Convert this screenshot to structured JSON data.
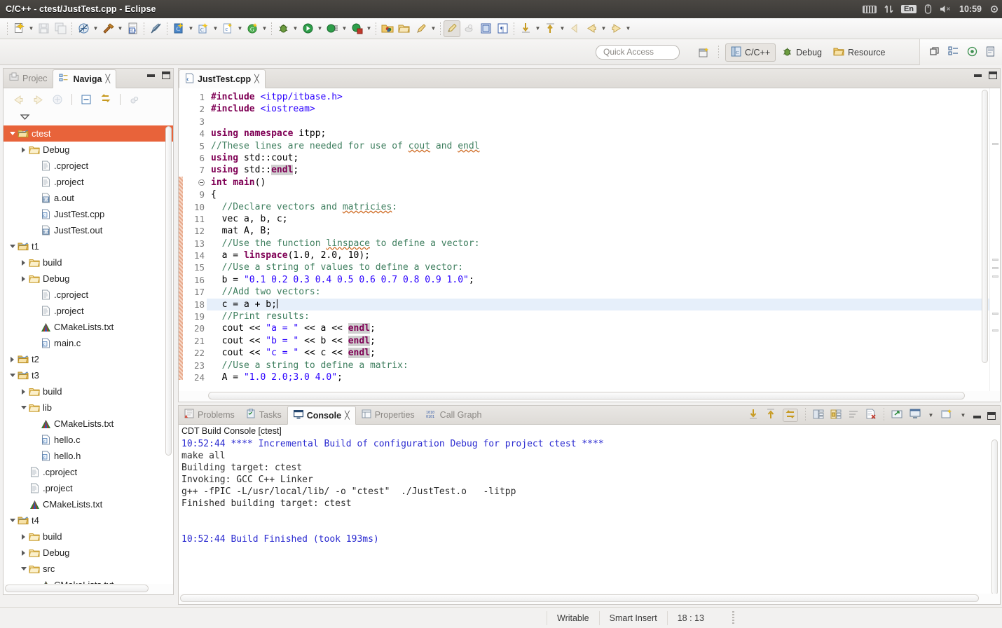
{
  "window": {
    "title": "C/C++ - ctest/JustTest.cpp - Eclipse"
  },
  "systray": {
    "keyboard_icon": "keyboard-icon",
    "network_icon": "network-updown-icon",
    "language": "En",
    "bluetooth_icon": "bluetooth-icon",
    "volume_icon": "volume-muted-icon",
    "clock": "10:59",
    "power_icon": "gear-power-icon"
  },
  "toolbar": {
    "groups": [
      {
        "items": [
          {
            "name": "new-button",
            "icon": "new-file-icon",
            "arrow": true
          },
          {
            "name": "save-button",
            "icon": "save-icon",
            "arrow": false,
            "disabled": true
          },
          {
            "name": "save-all-button",
            "icon": "save-all-icon",
            "arrow": false,
            "disabled": true
          }
        ]
      },
      {
        "items": [
          {
            "name": "build-all-button",
            "icon": "build-all-icon",
            "arrow": true
          },
          {
            "name": "build-button",
            "icon": "hammer-icon",
            "arrow": true
          },
          {
            "name": "binary-button",
            "icon": "binary-file-icon",
            "arrow": false
          }
        ]
      },
      {
        "items": [
          {
            "name": "toggle-markers-button",
            "icon": "pencil-strike-icon",
            "arrow": false
          }
        ]
      },
      {
        "items": [
          {
            "name": "new-c-project-button",
            "icon": "c-project-icon",
            "arrow": true
          },
          {
            "name": "new-cpp-class-button",
            "icon": "cpp-class-icon",
            "arrow": true
          },
          {
            "name": "new-c-file-button",
            "icon": "c-file-icon",
            "arrow": true
          },
          {
            "name": "new-git-button",
            "icon": "green-new-icon",
            "arrow": true
          }
        ]
      },
      {
        "items": [
          {
            "name": "debug-button",
            "icon": "bug-icon",
            "arrow": true
          },
          {
            "name": "run-button",
            "icon": "run-green-icon",
            "arrow": true
          },
          {
            "name": "profile-button",
            "icon": "profile-icon",
            "arrow": true
          },
          {
            "name": "stop-build-button",
            "icon": "run-stop-icon",
            "arrow": true
          }
        ]
      },
      {
        "items": [
          {
            "name": "open-element-button",
            "icon": "open-element-icon",
            "arrow": false
          },
          {
            "name": "search-resource-button",
            "icon": "color-folder-icon",
            "arrow": false
          },
          {
            "name": "open-folder-button",
            "icon": "open-folder-icon",
            "arrow": false
          },
          {
            "name": "search-button",
            "icon": "pencil-search-icon",
            "arrow": true
          }
        ]
      },
      {
        "items": [
          {
            "name": "toggle-mark-occurrences-button",
            "icon": "marker-pen-icon",
            "arrow": false,
            "active": true
          },
          {
            "name": "toggle-macro-button",
            "icon": "macro-icon",
            "arrow": false,
            "disabled": true
          },
          {
            "name": "toggle-block-selection-button",
            "icon": "block-selection-icon",
            "arrow": false
          },
          {
            "name": "show-whitespace-button",
            "icon": "pilcrow-icon",
            "arrow": false
          }
        ]
      },
      {
        "items": [
          {
            "name": "next-annotation-button",
            "icon": "arrow-down-yellow-icon",
            "arrow": true
          },
          {
            "name": "prev-annotation-button",
            "icon": "arrow-up-yellow-icon",
            "arrow": true
          },
          {
            "name": "last-edit-location-button",
            "icon": "last-edit-icon",
            "arrow": false
          },
          {
            "name": "back-button",
            "icon": "arrow-left-yellow-icon",
            "arrow": true
          },
          {
            "name": "forward-button",
            "icon": "arrow-right-yellow-icon",
            "arrow": true
          }
        ]
      }
    ]
  },
  "quick_access": {
    "placeholder": "Quick Access"
  },
  "perspectives": {
    "open_perspective_icon": "open-perspective-icon",
    "items": [
      {
        "name": "perspective-cpp",
        "label": "C/C++",
        "icon": "cpp-perspective-icon",
        "selected": true
      },
      {
        "name": "perspective-debug",
        "label": "Debug",
        "icon": "bug-icon",
        "selected": false
      },
      {
        "name": "perspective-resource",
        "label": "Resource",
        "icon": "resource-folder-icon",
        "selected": false
      }
    ],
    "right_icons": [
      "restore-icon",
      "outline-icon",
      "target-icon",
      "document-icon"
    ]
  },
  "left_panel": {
    "tabs": [
      {
        "name": "tab-project-explorer",
        "label": "Projec",
        "icon": "project-explorer-icon",
        "selected": false
      },
      {
        "name": "tab-navigator",
        "label": "Naviga",
        "icon": "navigator-icon",
        "selected": true,
        "closable": true
      }
    ],
    "local_toolbar": [
      "back-icon",
      "forward-icon",
      "link-with-editor-icon",
      "collapse-all-icon",
      "link-icon",
      "filter-icon"
    ],
    "view_menu_icon": "view-menu-icon",
    "minimize_icon": "minimize-icon",
    "maximize_icon": "maximize-icon",
    "tree": [
      {
        "label": "ctest",
        "icon": "project-icon",
        "depth": 0,
        "twisty": "open",
        "selected": true
      },
      {
        "label": "Debug",
        "icon": "folder-icon",
        "depth": 1,
        "twisty": "closed"
      },
      {
        "label": ".cproject",
        "icon": "file-icon",
        "depth": 2,
        "twisty": "none"
      },
      {
        "label": ".project",
        "icon": "file-icon",
        "depth": 2,
        "twisty": "none"
      },
      {
        "label": "a.out",
        "icon": "binary-icon",
        "depth": 2,
        "twisty": "none"
      },
      {
        "label": "JustTest.cpp",
        "icon": "cpp-file-icon",
        "depth": 2,
        "twisty": "none"
      },
      {
        "label": "JustTest.out",
        "icon": "binary-icon",
        "depth": 2,
        "twisty": "none"
      },
      {
        "label": "t1",
        "icon": "project-icon",
        "depth": 0,
        "twisty": "open"
      },
      {
        "label": "build",
        "icon": "folder-icon",
        "depth": 1,
        "twisty": "closed"
      },
      {
        "label": "Debug",
        "icon": "folder-icon",
        "depth": 1,
        "twisty": "closed"
      },
      {
        "label": ".cproject",
        "icon": "file-icon",
        "depth": 2,
        "twisty": "none"
      },
      {
        "label": ".project",
        "icon": "file-icon",
        "depth": 2,
        "twisty": "none"
      },
      {
        "label": "CMakeLists.txt",
        "icon": "cmake-icon",
        "depth": 2,
        "twisty": "none"
      },
      {
        "label": "main.c",
        "icon": "c-file-icon",
        "depth": 2,
        "twisty": "none"
      },
      {
        "label": "t2",
        "icon": "project-icon",
        "depth": 0,
        "twisty": "closed"
      },
      {
        "label": "t3",
        "icon": "project-icon",
        "depth": 0,
        "twisty": "open"
      },
      {
        "label": "build",
        "icon": "folder-icon",
        "depth": 1,
        "twisty": "closed"
      },
      {
        "label": "lib",
        "icon": "folder-icon",
        "depth": 1,
        "twisty": "open"
      },
      {
        "label": "CMakeLists.txt",
        "icon": "cmake-icon",
        "depth": 2,
        "twisty": "none"
      },
      {
        "label": "hello.c",
        "icon": "c-file-icon",
        "depth": 2,
        "twisty": "none"
      },
      {
        "label": "hello.h",
        "icon": "c-file-icon",
        "depth": 2,
        "twisty": "none"
      },
      {
        "label": ".cproject",
        "icon": "file-icon",
        "depth": 1,
        "twisty": "none"
      },
      {
        "label": ".project",
        "icon": "file-icon",
        "depth": 1,
        "twisty": "none"
      },
      {
        "label": "CMakeLists.txt",
        "icon": "cmake-icon",
        "depth": 1,
        "twisty": "none"
      },
      {
        "label": "t4",
        "icon": "project-icon",
        "depth": 0,
        "twisty": "open"
      },
      {
        "label": "build",
        "icon": "folder-icon",
        "depth": 1,
        "twisty": "closed"
      },
      {
        "label": "Debug",
        "icon": "folder-icon",
        "depth": 1,
        "twisty": "closed"
      },
      {
        "label": "src",
        "icon": "folder-icon",
        "depth": 1,
        "twisty": "open"
      },
      {
        "label": "CMakeLists.txt",
        "icon": "cmake-icon",
        "depth": 2,
        "twisty": "none"
      }
    ]
  },
  "editor": {
    "tab": {
      "label": "JustTest.cpp",
      "icon": "cpp-file-icon",
      "close": "⌧"
    },
    "minimize_icon": "minimize-icon",
    "maximize_icon": "maximize-icon",
    "cursor_line": 18,
    "lines": [
      {
        "n": 1,
        "text": "#include <itpp/itbase.h>"
      },
      {
        "n": 2,
        "text": "#include <iostream>"
      },
      {
        "n": 3,
        "text": ""
      },
      {
        "n": 4,
        "text": "using namespace itpp;"
      },
      {
        "n": 5,
        "text": "//These lines are needed for use of cout and endl"
      },
      {
        "n": 6,
        "text": "using std::cout;"
      },
      {
        "n": 7,
        "text": "using std::endl;"
      },
      {
        "n": 8,
        "text": "int main()"
      },
      {
        "n": 9,
        "text": "{"
      },
      {
        "n": 10,
        "text": "  //Declare vectors and matricies:"
      },
      {
        "n": 11,
        "text": "  vec a, b, c;"
      },
      {
        "n": 12,
        "text": "  mat A, B;"
      },
      {
        "n": 13,
        "text": "  //Use the function linspace to define a vector:"
      },
      {
        "n": 14,
        "text": "  a = linspace(1.0, 2.0, 10);"
      },
      {
        "n": 15,
        "text": "  //Use a string of values to define a vector:"
      },
      {
        "n": 16,
        "text": "  b = \"0.1 0.2 0.3 0.4 0.5 0.6 0.7 0.8 0.9 1.0\";"
      },
      {
        "n": 17,
        "text": "  //Add two vectors:"
      },
      {
        "n": 18,
        "text": "  c = a + b;"
      },
      {
        "n": 19,
        "text": "  //Print results:"
      },
      {
        "n": 20,
        "text": "  cout << \"a = \" << a << endl;"
      },
      {
        "n": 21,
        "text": "  cout << \"b = \" << b << endl;"
      },
      {
        "n": 22,
        "text": "  cout << \"c = \" << c << endl;"
      },
      {
        "n": 23,
        "text": "  //Use a string to define a matrix:"
      },
      {
        "n": 24,
        "text": "  A = \"1.0 2.0;3.0 4.0\";"
      }
    ]
  },
  "bottom_panel": {
    "tabs": [
      {
        "name": "tab-problems",
        "label": "Problems",
        "icon": "problems-icon",
        "selected": false
      },
      {
        "name": "tab-tasks",
        "label": "Tasks",
        "icon": "tasks-icon",
        "selected": false
      },
      {
        "name": "tab-console",
        "label": "Console",
        "icon": "console-icon",
        "selected": true,
        "closable": true
      },
      {
        "name": "tab-properties",
        "label": "Properties",
        "icon": "properties-icon",
        "selected": false
      },
      {
        "name": "tab-call-graph",
        "label": "Call Graph",
        "icon": "call-graph-icon",
        "selected": false
      }
    ],
    "toolbar": [
      {
        "name": "scroll-down-button",
        "icon": "arrow-down-yellow-icon"
      },
      {
        "name": "scroll-up-button",
        "icon": "arrow-up-yellow-icon"
      },
      {
        "name": "scroll-lock-button",
        "icon": "scroll-lock-icon",
        "active": true
      },
      {
        "name": "show-console-button",
        "icon": "show-console-icon"
      },
      {
        "name": "pin-console-button",
        "icon": "pin-console-icon"
      },
      {
        "name": "clear-console-button",
        "icon": "clear-console-icon",
        "disabled": true
      },
      {
        "name": "remove-console-button",
        "icon": "remove-console-icon"
      },
      {
        "name": "open-console-button",
        "icon": "open-console-icon"
      },
      {
        "name": "display-console-button",
        "icon": "display-console-icon",
        "arrow": true
      },
      {
        "name": "new-console-button",
        "icon": "new-console-icon",
        "arrow": true
      },
      {
        "name": "minimize-button",
        "icon": "minimize-icon"
      },
      {
        "name": "maximize-button",
        "icon": "maximize-icon"
      }
    ],
    "console_title": "CDT Build Console [ctest]",
    "console_lines": [
      {
        "text": "10:52:44 **** Incremental Build of configuration Debug for project ctest ****",
        "color": "blue"
      },
      {
        "text": "make all",
        "color": "black"
      },
      {
        "text": "Building target: ctest",
        "color": "black"
      },
      {
        "text": "Invoking: GCC C++ Linker",
        "color": "black"
      },
      {
        "text": "g++ -fPIC -L/usr/local/lib/ -o \"ctest\"  ./JustTest.o   -litpp",
        "color": "black"
      },
      {
        "text": "Finished building target: ctest",
        "color": "black"
      },
      {
        "text": "",
        "color": "black"
      },
      {
        "text": "",
        "color": "black"
      },
      {
        "text": "10:52:44 Build Finished (took 193ms)",
        "color": "blue"
      }
    ]
  },
  "status_bar": {
    "writable": "Writable",
    "insert_mode": "Smart Insert",
    "position": "18 : 13"
  },
  "colors": {
    "selection": "#e8633a",
    "keyword": "#7f0055",
    "comment": "#3f7f5f",
    "string": "#2a00ff",
    "console_blue": "#2a2ad0",
    "titlebar": "#3b3936"
  }
}
